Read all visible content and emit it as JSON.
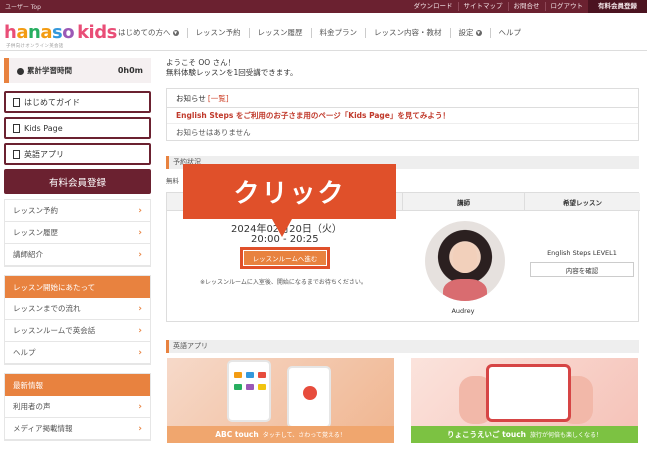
{
  "topbar": {
    "crumb": "ユーザー Top",
    "links": [
      "ダウンロード",
      "サイトマップ",
      "お問合せ",
      "ログアウト"
    ],
    "paid": "有料会員登録"
  },
  "header": {
    "logo": {
      "h": "h",
      "a": "a",
      "n": "n",
      "a2": "a",
      "s": "s",
      "o": "o",
      "kids": "kids"
    },
    "logo_sub": "子供向けオンライン英会話",
    "nav": [
      "はじめての方へ",
      "レッスン予約",
      "レッスン履歴",
      "料金プラン",
      "レッスン内容・教材",
      "設定",
      "ヘルプ"
    ]
  },
  "sidebar": {
    "study_label": "累計学習時間",
    "study_value": "0h0m",
    "guides": [
      "はじめてガイド",
      "Kids Page",
      "英語アプリ"
    ],
    "register": "有料会員登録",
    "menu1": [
      "レッスン予約",
      "レッスン履歴",
      "講師紹介"
    ],
    "group2_head": "レッスン開始にあたって",
    "menu2": [
      "レッスンまでの流れ",
      "レッスンルームで英会話",
      "ヘルプ"
    ],
    "group3_head": "最新情報",
    "menu3": [
      "利用者の声",
      "メディア掲載情報"
    ]
  },
  "main": {
    "welcome1": "ようこそ OO さん！",
    "welcome2": "無料体験レッスンを1回受講できます。",
    "notice_head": "お知らせ",
    "notice_more": "[一覧]",
    "notice_link": "English Steps をご利用のお子さま用のページ「Kids Page」を見てみよう！",
    "notice_none": "お知らせはありません"
  },
  "reservation": {
    "title": "予約状況",
    "sub": "無料",
    "col_tutor": "講師",
    "col_lesson": "希望レッスン",
    "date": "2024年02月20日（火）",
    "time": "20:00 - 20:25",
    "room_button": "レッスンルームへ進む",
    "room_note": "※レッスンルームに入室後、開始になるまでお待ちください。",
    "tutor_name": "Audrey",
    "lesson_name": "English Steps LEVEL1",
    "detail_button": "内容を確認"
  },
  "callout": "クリック",
  "apps": {
    "title": "英語アプリ",
    "app1_name": "ABC touch",
    "app1_desc": "タッチして、さわって覚える！",
    "app2_name": "りょこうえいご touch",
    "app2_desc": "旅行が何倍も楽しくなる！"
  },
  "colors": {
    "brand": "#6b2130",
    "accent": "#e8823f",
    "callout": "#e0502a"
  }
}
